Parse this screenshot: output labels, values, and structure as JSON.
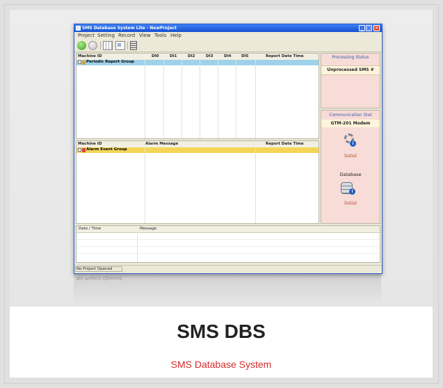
{
  "window": {
    "title": "SMS Database System Lite - NewProject",
    "controls": [
      "_",
      "□",
      "✕"
    ]
  },
  "menu": [
    "Project",
    "Setting",
    "Record",
    "View",
    "Tools",
    "Help"
  ],
  "toolbar_icons": [
    "connect-icon",
    "disconnect-icon",
    "grid-view-icon",
    "card-view-icon",
    "database-icon"
  ],
  "report_panel": {
    "columns": [
      "Machine ID",
      "DI0",
      "DI1",
      "DI2",
      "DI3",
      "DI4",
      "DI5",
      "Report Date Time"
    ],
    "group_label": "Periodic Report Group"
  },
  "alarm_panel": {
    "columns": [
      "Machine ID",
      "Alarm Message",
      "Report Date Time"
    ],
    "group_label": "Alarm Event Group"
  },
  "processing_status": {
    "title": "Processing Status",
    "header": "Unprocessed SMS #"
  },
  "communication_status": {
    "title": "Communication Stat",
    "modem": "GTM-201 Modem",
    "modem_state": "Initial",
    "database_label": "Database",
    "database_state": "Initial"
  },
  "log_panel": {
    "columns": [
      "Date / Time",
      "Message"
    ]
  },
  "statusbar": {
    "text": "No Project Opened",
    "reflection": "No Project Opened"
  },
  "caption": {
    "title": "SMS DBS",
    "subtitle": "SMS Database System"
  },
  "colors": {
    "accent_red": "#d42b2b",
    "report_group": "#9fd2ea",
    "alarm_group": "#f4d558",
    "status_panel": "#f7dcd7"
  }
}
